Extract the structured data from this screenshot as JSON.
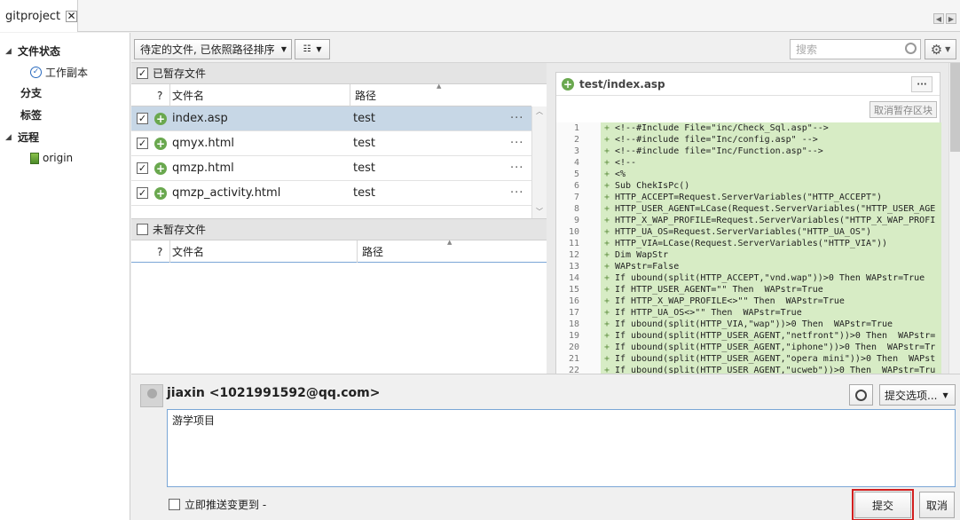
{
  "tab": {
    "title": "gitproject",
    "close": "✕"
  },
  "sidebar": {
    "file_status": "文件状态",
    "working_copy": "工作副本",
    "branches": "分支",
    "tags": "标签",
    "remotes": "远程",
    "origin": "origin"
  },
  "toolbar": {
    "sort_label": "待定的文件, 已依照路径排序",
    "search_placeholder": "搜索"
  },
  "staged": {
    "title": "已暂存文件",
    "col_q": "?",
    "col_name": "文件名",
    "col_path": "路径",
    "rows": [
      {
        "name": "index.asp",
        "path": "test",
        "more": "···"
      },
      {
        "name": "qmyx.html",
        "path": "test",
        "more": "···"
      },
      {
        "name": "qmzp.html",
        "path": "test",
        "more": "···"
      },
      {
        "name": "qmzp_activity.html",
        "path": "test",
        "more": "···"
      }
    ]
  },
  "unstaged": {
    "title": "未暂存文件",
    "col_q": "?",
    "col_name": "文件名",
    "col_path": "路径"
  },
  "diff": {
    "file": "test/index.asp",
    "dots": "···",
    "unstage_label": "取消暂存区块",
    "lines": [
      {
        "n": "1",
        "t": "<!--#Include File=\"inc/Check_Sql.asp\"-->"
      },
      {
        "n": "2",
        "t": "<!--#include file=\"Inc/config.asp\" -->"
      },
      {
        "n": "3",
        "t": "<!--#include file=\"Inc/Function.asp\"-->"
      },
      {
        "n": "4",
        "t": "<!--"
      },
      {
        "n": "5",
        "t": "<%"
      },
      {
        "n": "6",
        "t": "Sub ChekIsPc()"
      },
      {
        "n": "7",
        "t": "HTTP_ACCEPT=Request.ServerVariables(\"HTTP_ACCEPT\")"
      },
      {
        "n": "8",
        "t": "HTTP_USER_AGENT=LCase(Request.ServerVariables(\"HTTP_USER_AGE"
      },
      {
        "n": "9",
        "t": "HTTP_X_WAP_PROFILE=Request.ServerVariables(\"HTTP_X_WAP_PROFI"
      },
      {
        "n": "10",
        "t": "HTTP_UA_OS=Request.ServerVariables(\"HTTP_UA_OS\")"
      },
      {
        "n": "11",
        "t": "HTTP_VIA=LCase(Request.ServerVariables(\"HTTP_VIA\"))"
      },
      {
        "n": "12",
        "t": "Dim WapStr"
      },
      {
        "n": "13",
        "t": "WAPstr=False"
      },
      {
        "n": "14",
        "t": "If ubound(split(HTTP_ACCEPT,\"vnd.wap\"))>0 Then WAPstr=True"
      },
      {
        "n": "15",
        "t": "If HTTP_USER_AGENT=\"\" Then  WAPstr=True"
      },
      {
        "n": "16",
        "t": "If HTTP_X_WAP_PROFILE<>\"\" Then  WAPstr=True"
      },
      {
        "n": "17",
        "t": "If HTTP_UA_OS<>\"\" Then  WAPstr=True"
      },
      {
        "n": "18",
        "t": "If ubound(split(HTTP_VIA,\"wap\"))>0 Then  WAPstr=True"
      },
      {
        "n": "19",
        "t": "If ubound(split(HTTP_USER_AGENT,\"netfront\"))>0 Then  WAPstr="
      },
      {
        "n": "20",
        "t": "If ubound(split(HTTP_USER_AGENT,\"iphone\"))>0 Then  WAPstr=Tr"
      },
      {
        "n": "21",
        "t": "If ubound(split(HTTP_USER_AGENT,\"opera mini\"))>0 Then  WAPst"
      },
      {
        "n": "22",
        "t": "If ubound(split(HTTP_USER_AGENT,\"ucweb\"))>0 Then  WAPstr=Tru"
      }
    ]
  },
  "commit": {
    "author": "jiaxin <1021991592@qq.com>",
    "options_label": "提交选项...",
    "message": "游学项目",
    "push_label": "立即推送变更到 -",
    "submit_label": "提交",
    "cancel_label": "取消"
  },
  "colors": {
    "selection": "#c7d7e6",
    "diff_add": "#d7ecc5",
    "highlight_frame": "#d21f1f"
  }
}
